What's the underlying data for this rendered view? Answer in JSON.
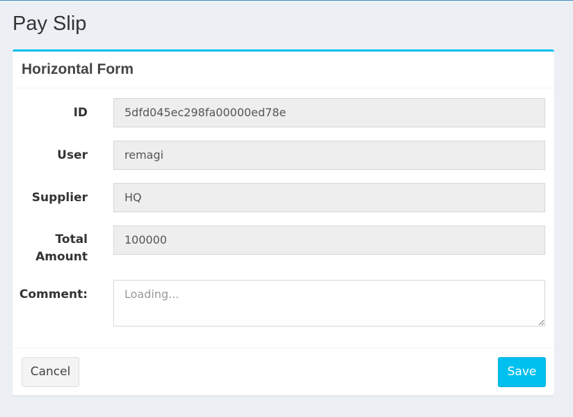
{
  "page": {
    "title": "Pay Slip"
  },
  "box": {
    "title": "Horizontal Form"
  },
  "form": {
    "id": {
      "label": "ID",
      "value": "5dfd045ec298fa00000ed78e"
    },
    "user": {
      "label": "User",
      "value": "remagi"
    },
    "supplier": {
      "label": "Supplier",
      "value": "HQ"
    },
    "total_amount": {
      "label_line1": "Total",
      "label_line2": "Amount",
      "value": "100000"
    },
    "comment": {
      "label": "Comment:",
      "placeholder": "Loading..."
    }
  },
  "footer": {
    "cancel_label": "Cancel",
    "save_label": "Save"
  },
  "colors": {
    "accent": "#00c0ef",
    "background": "#ecf0f5",
    "readonly_bg": "#eeeeee"
  }
}
